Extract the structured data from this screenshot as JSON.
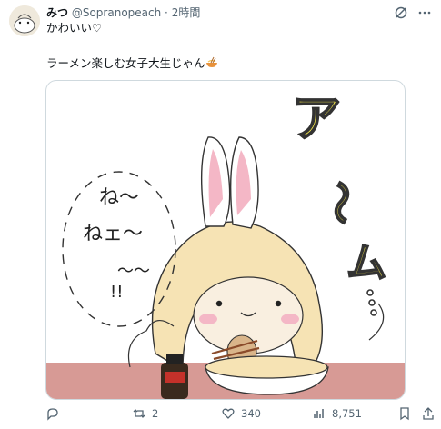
{
  "tweet": {
    "display_name": "みつ",
    "handle": "@Sopranopeach",
    "separator": "·",
    "time": "2時間",
    "line1": "かわいい♡",
    "line2": "ラーメン楽しむ女子大生じゃん",
    "line2_emoji": "ramen-bowl-emoji"
  },
  "header_icons": [
    "grok-icon",
    "more-icon"
  ],
  "media": {
    "speech_left": [
      "ね〜",
      "ねェ〜",
      "〜〜",
      "!!"
    ],
    "speech_right": [
      "ア",
      "〜",
      "ム",
      "..."
    ]
  },
  "actions": {
    "replies": "",
    "retweets": "2",
    "likes": "340",
    "views": "8,751"
  },
  "colors": {
    "text": "#0f1419",
    "muted": "#536471",
    "border": "#cfd9de",
    "yellow": "#f7e94a",
    "hair": "#f6e3b4",
    "ear_pink": "#f4b7c6",
    "table": "#d79a95"
  }
}
